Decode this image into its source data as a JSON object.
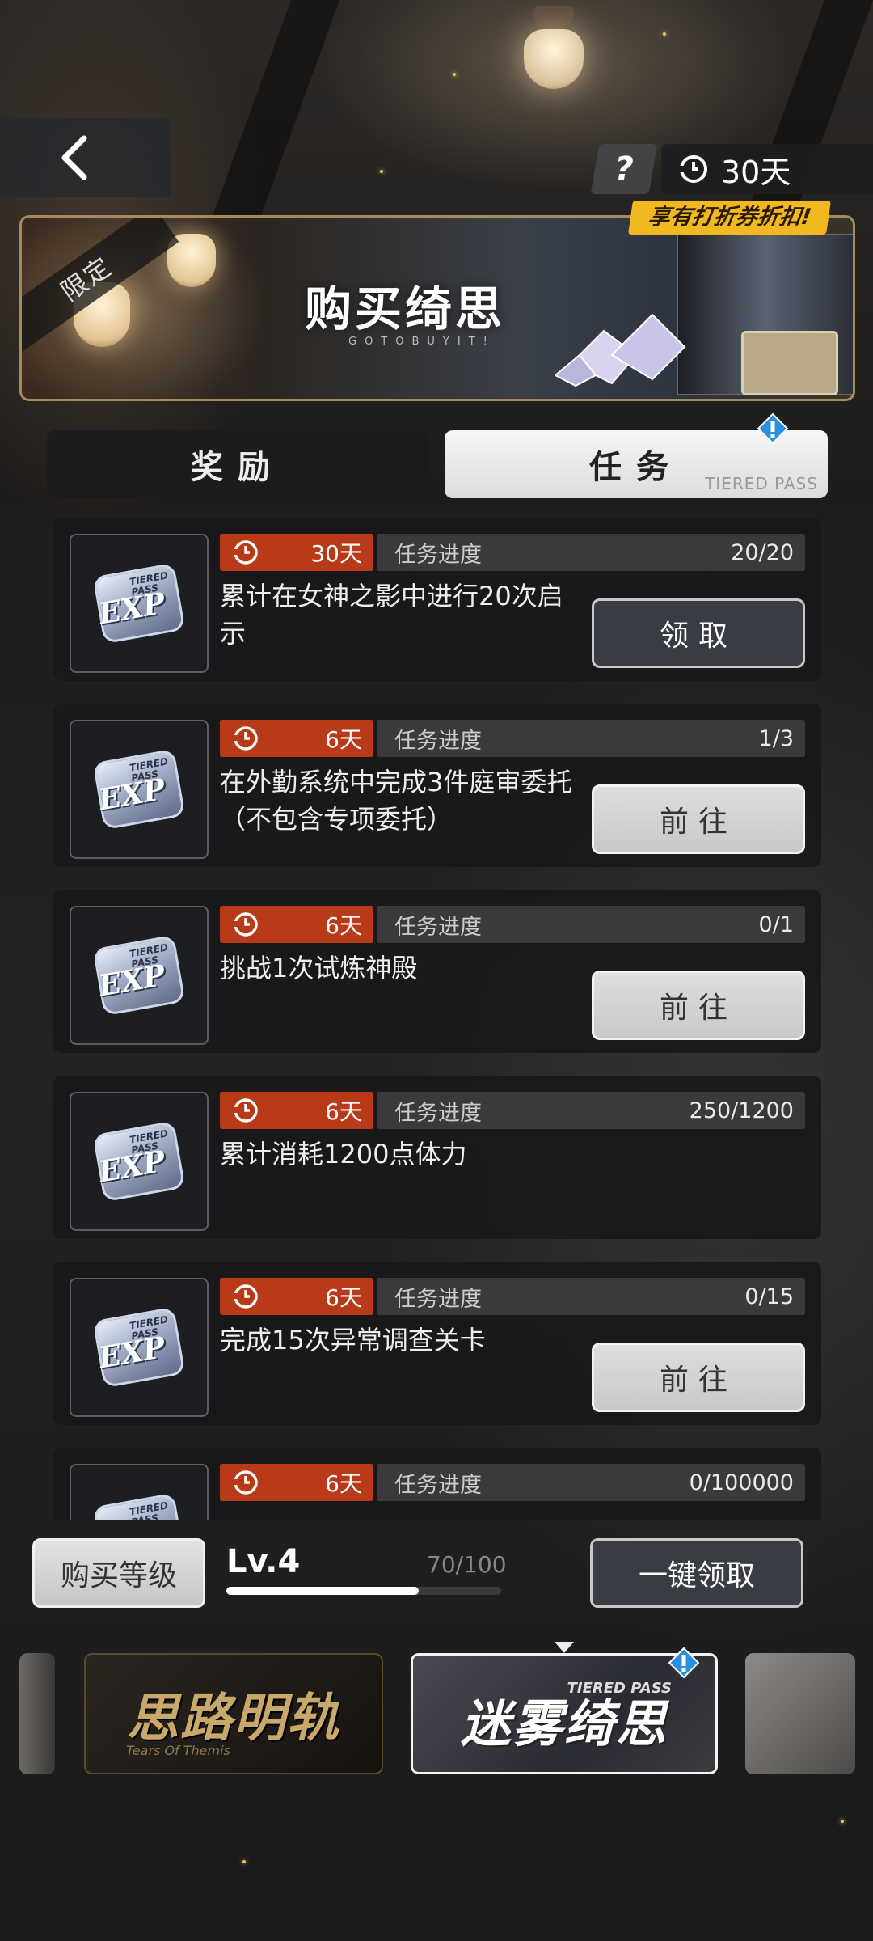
{
  "header": {
    "help_label": "?",
    "timer_label": "30天"
  },
  "banner": {
    "limited_label": "限定",
    "title": "购买绮思",
    "subtitle": "GOTOBUYIT!",
    "discount_label": "享有打折券折扣!"
  },
  "tabs": [
    {
      "label": "奖励",
      "active": false
    },
    {
      "label": "任务",
      "active": true,
      "sub": "TIERED PASS"
    }
  ],
  "tasks": [
    {
      "days": "30天",
      "progress_label": "任务进度",
      "progress": "20/20",
      "desc": "累计在女神之影中进行20次启示",
      "action": "领取",
      "action_type": "claim"
    },
    {
      "days": "6天",
      "progress_label": "任务进度",
      "progress": "1/3",
      "desc": "在外勤系统中完成3件庭审委托（不包含专项委托）",
      "action": "前往",
      "action_type": "goto"
    },
    {
      "days": "6天",
      "progress_label": "任务进度",
      "progress": "0/1",
      "desc": "挑战1次试炼神殿",
      "action": "前往",
      "action_type": "goto"
    },
    {
      "days": "6天",
      "progress_label": "任务进度",
      "progress": "250/1200",
      "desc": "累计消耗1200点体力",
      "action": "",
      "action_type": "none"
    },
    {
      "days": "6天",
      "progress_label": "任务进度",
      "progress": "0/15",
      "desc": "完成15次异常调查关卡",
      "action": "前往",
      "action_type": "goto"
    },
    {
      "days": "6天",
      "progress_label": "任务进度",
      "progress": "0/100000",
      "desc": "",
      "action": "",
      "action_type": "none"
    }
  ],
  "exp_badge": {
    "text": "EXP",
    "mini": "TIERED PASS"
  },
  "level": {
    "buy_label": "购买等级",
    "level_label": "Lv.4",
    "count_label": "70/100",
    "progress": 0.7,
    "claim_all_label": "一键领取"
  },
  "passes": {
    "pass1_title": "思路明轨",
    "pass1_sub": "Tears Of Themis",
    "pass2_title": "迷雾绮思",
    "pass2_sub": "TIERED PASS"
  },
  "colors": {
    "time_tag": "#b83a18",
    "discount": "#f2b820",
    "alert": "#2b8fe0"
  }
}
